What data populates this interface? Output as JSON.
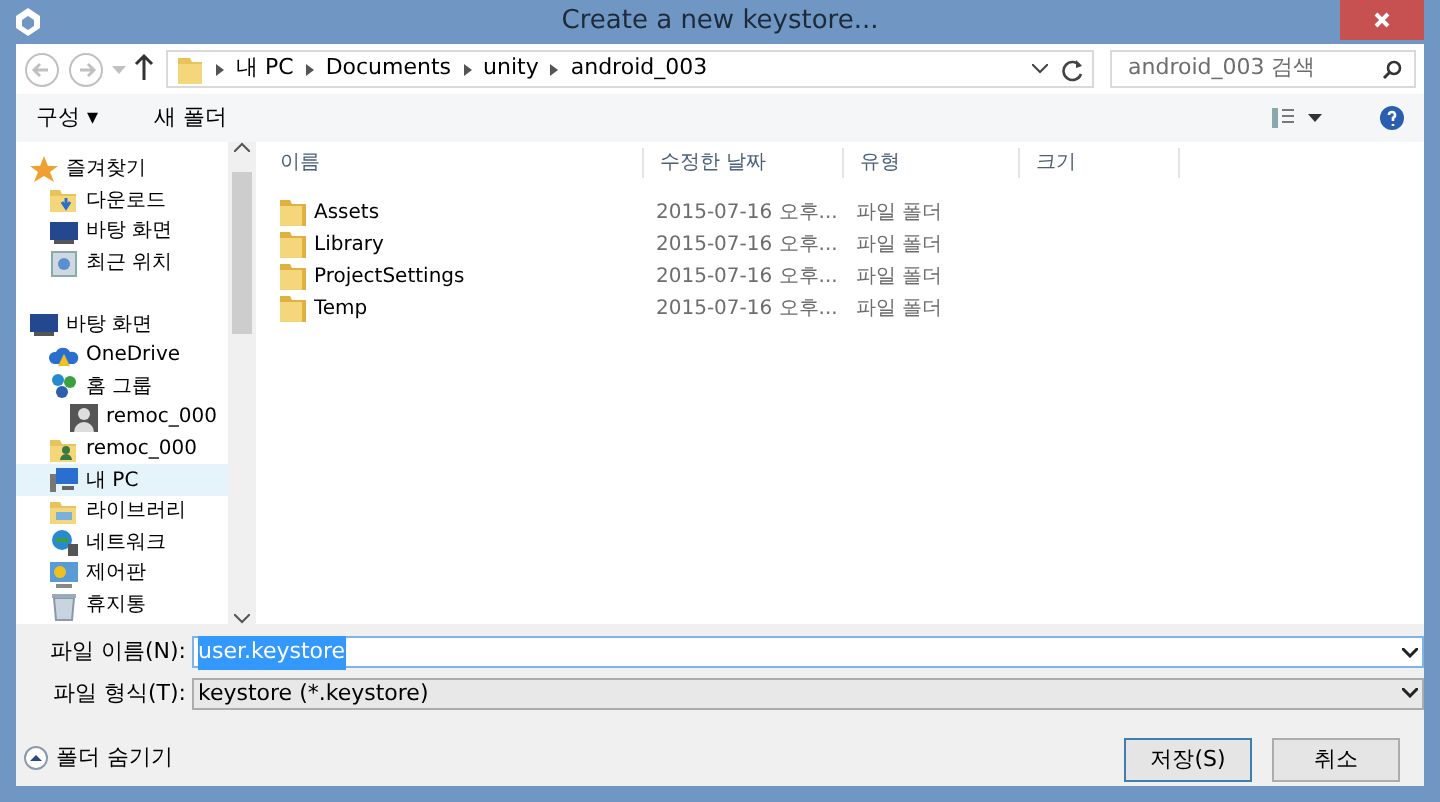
{
  "window": {
    "title": "Create a new keystore..."
  },
  "address": {
    "crumbs": [
      "내 PC",
      "Documents",
      "unity",
      "android_003"
    ]
  },
  "search": {
    "placeholder": "android_003 검색"
  },
  "toolbar": {
    "organize": "구성",
    "organize_caret": "▾",
    "new_folder": "새 폴더"
  },
  "sidebar": {
    "items": [
      {
        "label": "즐겨찾기",
        "kind": "star",
        "selected": false,
        "children": [
          {
            "label": "다운로드",
            "kind": "download",
            "selected": false
          },
          {
            "label": "바탕 화면",
            "kind": "monitor",
            "selected": false
          },
          {
            "label": "최근 위치",
            "kind": "recent",
            "selected": false
          }
        ]
      },
      {
        "label": "바탕 화면",
        "kind": "monitor",
        "selected": false,
        "children": [
          {
            "label": "OneDrive",
            "kind": "cloud",
            "selected": false
          },
          {
            "label": "홈 그룹",
            "kind": "homegroup",
            "selected": false,
            "children": [
              {
                "label": "remoc_000",
                "kind": "person",
                "selected": false
              }
            ]
          },
          {
            "label": "remoc_000",
            "kind": "userfolder",
            "selected": false
          },
          {
            "label": "내 PC",
            "kind": "pc",
            "selected": true
          },
          {
            "label": "라이브러리",
            "kind": "library",
            "selected": false
          },
          {
            "label": "네트워크",
            "kind": "network",
            "selected": false
          },
          {
            "label": "제어판",
            "kind": "control",
            "selected": false
          },
          {
            "label": "휴지통",
            "kind": "trash",
            "selected": false
          }
        ]
      }
    ]
  },
  "table": {
    "columns": [
      "이름",
      "수정한 날짜",
      "유형",
      "크기"
    ],
    "rows": [
      {
        "name": "Assets",
        "date": "2015-07-16 오후...",
        "type": "파일 폴더"
      },
      {
        "name": "Library",
        "date": "2015-07-16 오후...",
        "type": "파일 폴더"
      },
      {
        "name": "ProjectSettings",
        "date": "2015-07-16 오후...",
        "type": "파일 폴더"
      },
      {
        "name": "Temp",
        "date": "2015-07-16 오후...",
        "type": "파일 폴더"
      }
    ]
  },
  "form": {
    "filename_label": "파일 이름(N):",
    "filename": "user.keystore",
    "filetype_label": "파일 형식(T):",
    "filetype": "keystore (*.keystore)"
  },
  "footer": {
    "hide_folders": "폴더 숨기기",
    "buttons": [
      {
        "label": "저장(S)",
        "default": true
      },
      {
        "label": "취소",
        "default": false
      }
    ]
  }
}
